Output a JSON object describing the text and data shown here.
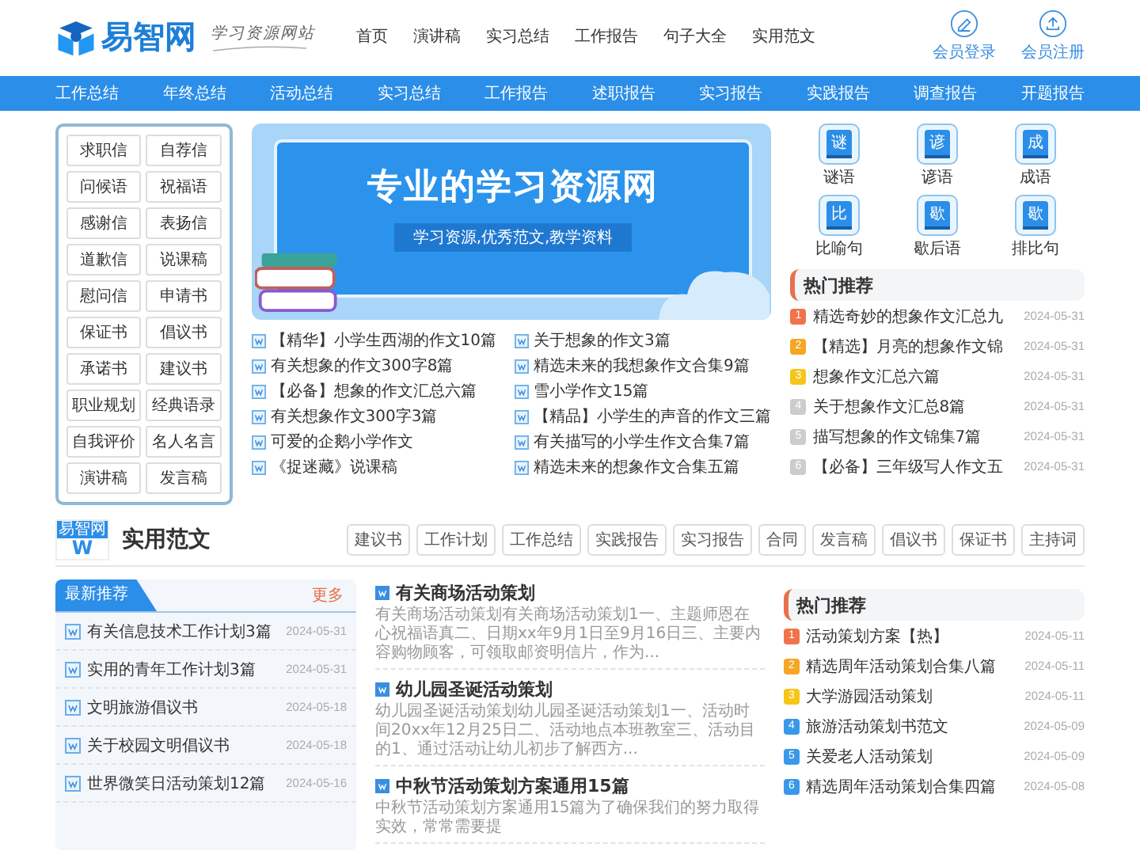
{
  "header": {
    "logo_text": "易智网",
    "slogan": "学习资源网站",
    "menu": [
      "首页",
      "演讲稿",
      "实习总结",
      "工作报告",
      "句子大全",
      "实用范文"
    ],
    "user_links": [
      {
        "label": "会员登录",
        "kind": "login"
      },
      {
        "label": "会员注册",
        "kind": "register"
      }
    ]
  },
  "nav": [
    "工作总结",
    "年终总结",
    "活动总结",
    "实习总结",
    "工作报告",
    "述职报告",
    "实习报告",
    "实践报告",
    "调查报告",
    "开题报告"
  ],
  "categories": [
    "求职信",
    "自荐信",
    "问候语",
    "祝福语",
    "感谢信",
    "表扬信",
    "道歉信",
    "说课稿",
    "慰问信",
    "申请书",
    "保证书",
    "倡议书",
    "承诺书",
    "建议书",
    "职业规划",
    "经典语录",
    "自我评价",
    "名人名言",
    "演讲稿",
    "发言稿"
  ],
  "banner": {
    "headline": "专业的学习资源网",
    "subline": "学习资源,优秀范文,教学资料"
  },
  "articles": [
    "【精华】小学生西湖的作文10篇",
    "关于想象的作文3篇",
    "有关想象的作文300字8篇",
    "精选未来的我想象作文合集9篇",
    "【必备】想象的作文汇总六篇",
    "雪小学作文15篇",
    "有关想象作文300字3篇",
    "【精品】小学生的声音的作文三篇",
    "可爱的企鹅小学作文",
    "有关描写的小学生作文合集7篇",
    "《捉迷藏》说课稿",
    "精选未来的想象作文合集五篇"
  ],
  "tools": [
    {
      "glyph": "谜",
      "label": "谜语"
    },
    {
      "glyph": "谚",
      "label": "谚语"
    },
    {
      "glyph": "成",
      "label": "成语"
    },
    {
      "glyph": "比",
      "label": "比喻句"
    },
    {
      "glyph": "歇",
      "label": "歇后语"
    },
    {
      "glyph": "歇",
      "label": "排比句"
    }
  ],
  "hot_top": {
    "title": "热门推荐",
    "items": [
      {
        "rank": "1",
        "title": "精选奇妙的想象作文汇总九",
        "date": "2024-05-31",
        "color": "#f0734a"
      },
      {
        "rank": "2",
        "title": "【精选】月亮的想象作文锦",
        "date": "2024-05-31",
        "color": "#f5a623"
      },
      {
        "rank": "3",
        "title": "想象作文汇总六篇",
        "date": "2024-05-31",
        "color": "#f5c518"
      },
      {
        "rank": "4",
        "title": "关于想象作文汇总8篇",
        "date": "2024-05-31",
        "color": "#cccccc"
      },
      {
        "rank": "5",
        "title": "描写想象的作文锦集7篇",
        "date": "2024-05-31",
        "color": "#cccccc"
      },
      {
        "rank": "6",
        "title": "【必备】三年级写人作文五",
        "date": "2024-05-31",
        "color": "#cccccc"
      }
    ]
  },
  "section": {
    "badge": "易智网",
    "letter": "W",
    "title": "实用范文",
    "tags": [
      "建议书",
      "工作计划",
      "工作总结",
      "实践报告",
      "实习报告",
      "合同",
      "发言稿",
      "倡议书",
      "保证书",
      "主持词"
    ]
  },
  "latest": {
    "title": "最新推荐",
    "more": "更多",
    "items": [
      {
        "title": "有关信息技术工作计划3篇",
        "date": "2024-05-31"
      },
      {
        "title": "实用的青年工作计划3篇",
        "date": "2024-05-31"
      },
      {
        "title": "文明旅游倡议书",
        "date": "2024-05-18"
      },
      {
        "title": "关于校园文明倡议书",
        "date": "2024-05-18"
      },
      {
        "title": "世界微笑日活动策划12篇",
        "date": "2024-05-16"
      }
    ]
  },
  "posts": [
    {
      "title": "有关商场活动策划",
      "snippet": "有关商场活动策划有关商场活动策划1一、主题师恩在心祝福语真二、日期xx年9月1日至9月16日三、主要内容购物顾客，可领取邮资明信片，作为..."
    },
    {
      "title": "幼儿园圣诞活动策划",
      "snippet": "幼儿园圣诞活动策划幼儿园圣诞活动策划1一、活动时间20xx年12月25日二、活动地点本班教室三、活动目的1、通过活动让幼儿初步了解西方..."
    },
    {
      "title": "中秋节活动策划方案通用15篇",
      "snippet": "中秋节活动策划方案通用15篇为了确保我们的努力取得实效，常常需要提"
    }
  ],
  "hot_bottom": {
    "title": "热门推荐",
    "items": [
      {
        "rank": "1",
        "title": "活动策划方案【热】",
        "date": "2024-05-11",
        "color": "#f0734a"
      },
      {
        "rank": "2",
        "title": "精选周年活动策划合集八篇",
        "date": "2024-05-11",
        "color": "#f5a623"
      },
      {
        "rank": "3",
        "title": "大学游园活动策划",
        "date": "2024-05-11",
        "color": "#f5c518"
      },
      {
        "rank": "4",
        "title": "旅游活动策划书范文",
        "date": "2024-05-09",
        "color": "#3a98e8"
      },
      {
        "rank": "5",
        "title": "关爱老人活动策划",
        "date": "2024-05-09",
        "color": "#3a98e8"
      },
      {
        "rank": "6",
        "title": "精选周年活动策划合集四篇",
        "date": "2024-05-08",
        "color": "#3a98e8"
      }
    ]
  }
}
